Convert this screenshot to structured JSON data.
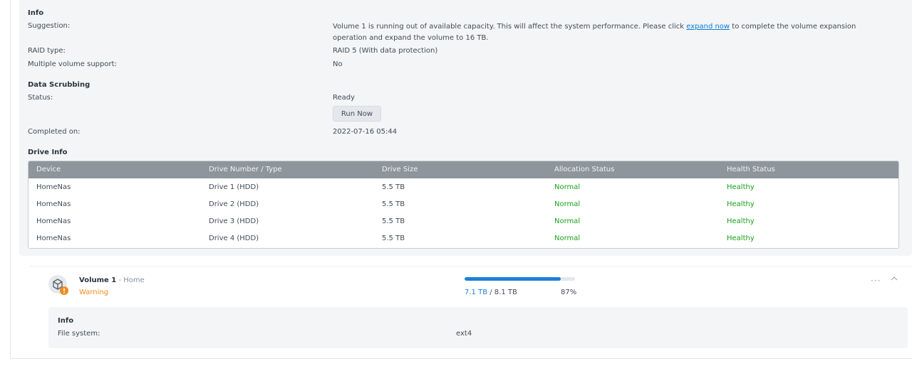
{
  "info": {
    "title": "Info",
    "suggestion_label": "Suggestion:",
    "suggestion_text_1": "Volume 1 is running out of available capacity. This will affect the system performance. Please click ",
    "suggestion_link": "expand now",
    "suggestion_text_2": " to complete the volume expansion",
    "suggestion_text_3": "operation and expand the volume to 16 TB.",
    "raid_label": "RAID type:",
    "raid_value": "RAID 5 (With data protection)",
    "multi_label": "Multiple volume support:",
    "multi_value": "No"
  },
  "scrubbing": {
    "title": "Data Scrubbing",
    "status_label": "Status:",
    "status_value": "Ready",
    "run_button": "Run Now",
    "completed_label": "Completed on:",
    "completed_value": "2022-07-16 05:44"
  },
  "drive_info": {
    "title": "Drive Info",
    "columns": [
      "Device",
      "Drive Number / Type",
      "Drive Size",
      "Allocation Status",
      "Health Status"
    ],
    "rows": [
      [
        "HomeNas",
        "Drive 1 (HDD)",
        "5.5 TB",
        "Normal",
        "Healthy"
      ],
      [
        "HomeNas",
        "Drive 2 (HDD)",
        "5.5 TB",
        "Normal",
        "Healthy"
      ],
      [
        "HomeNas",
        "Drive 3 (HDD)",
        "5.5 TB",
        "Normal",
        "Healthy"
      ],
      [
        "HomeNas",
        "Drive 4 (HDD)",
        "5.5 TB",
        "Normal",
        "Healthy"
      ]
    ]
  },
  "volume": {
    "name": "Volume 1",
    "separator": " - ",
    "description": "Home",
    "status": "Warning",
    "used": "7.1 TB",
    "total_sep": " / ",
    "total": "8.1 TB",
    "percent": "87%",
    "usage_fraction": 0.87,
    "info_title": "Info",
    "fs_label": "File system:",
    "fs_value": "ext4",
    "more_icon": "more-horizontal-icon",
    "collapse_icon": "chevron-up-icon"
  },
  "colors": {
    "accent": "#1a7fd8",
    "healthy": "#1aa01a",
    "warning": "#f08a1d"
  }
}
